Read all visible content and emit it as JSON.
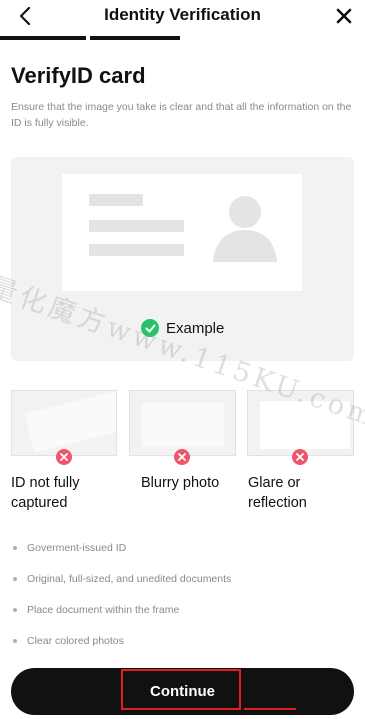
{
  "header": {
    "title": "Identity Verification"
  },
  "main": {
    "heading": "VerifyID card",
    "description": "Ensure that the image you take is clear and that all the information on the ID is fully visible.",
    "example_label": "Example"
  },
  "bad_examples": [
    {
      "label": "ID not fully captured"
    },
    {
      "label": "Blurry photo"
    },
    {
      "label": "Glare or reflection"
    }
  ],
  "requirements": [
    "Goverment-issued ID",
    "Original, full-sized, and unedited documents",
    "Place document within the frame",
    "Clear colored photos"
  ],
  "footer": {
    "continue_label": "Continue"
  },
  "watermark": {
    "text": "量化魔方www.115KU.com"
  },
  "colors": {
    "success": "#25c26b",
    "error": "#f0566a",
    "annotation": "#e02020",
    "button": "#111111"
  },
  "progress": {
    "total_steps": 2,
    "completed_steps": 2
  }
}
